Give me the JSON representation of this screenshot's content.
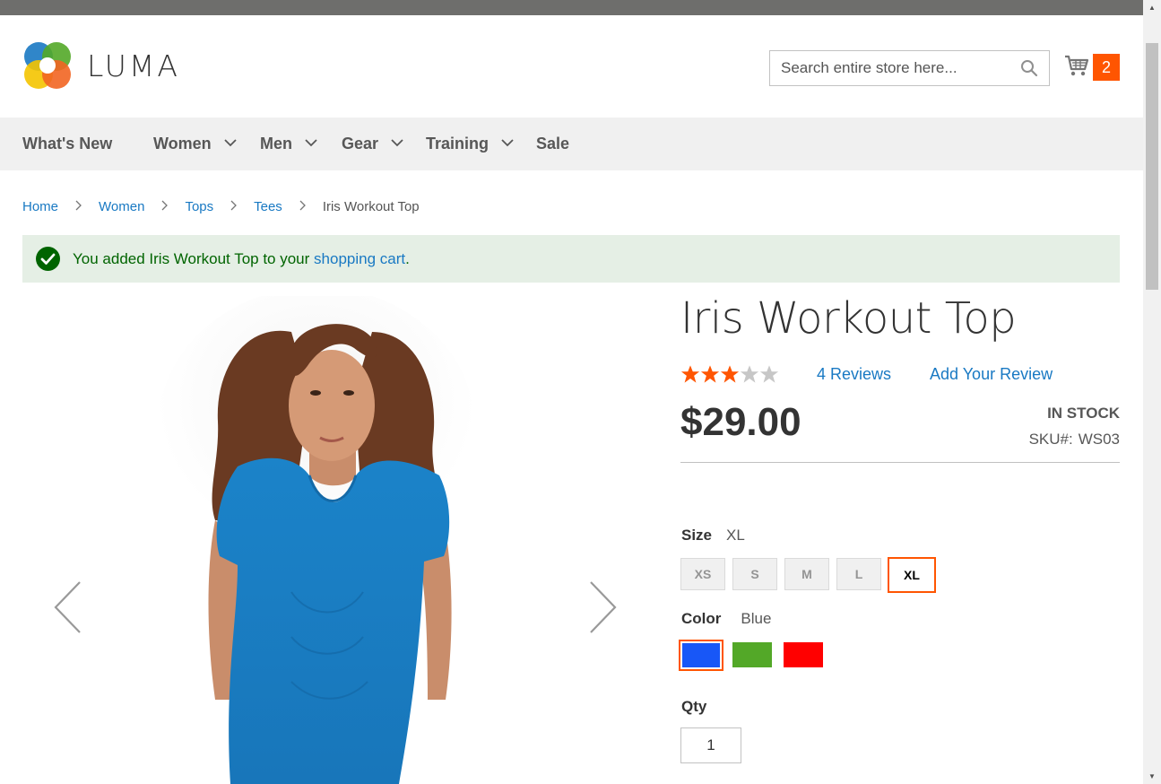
{
  "header": {
    "logo_text": "LUMA",
    "search": {
      "placeholder": "Search entire store here...",
      "value": ""
    },
    "cart": {
      "count": "2"
    }
  },
  "nav": {
    "items": [
      {
        "label": "What's New",
        "has_dropdown": false
      },
      {
        "label": "Women",
        "has_dropdown": true
      },
      {
        "label": "Men",
        "has_dropdown": true
      },
      {
        "label": "Gear",
        "has_dropdown": true
      },
      {
        "label": "Training",
        "has_dropdown": true
      },
      {
        "label": "Sale",
        "has_dropdown": false
      }
    ]
  },
  "breadcrumb": {
    "items": [
      "Home",
      "Women",
      "Tops",
      "Tees"
    ],
    "current": "Iris Workout Top"
  },
  "message": {
    "text_before": "You added Iris Workout Top to your ",
    "link_text": "shopping cart",
    "text_after": "."
  },
  "product": {
    "title": "Iris Workout Top",
    "rating": {
      "stars": 3,
      "max": 5
    },
    "reviews_link": "4  Reviews",
    "add_review_link": "Add Your Review",
    "price": "$29.00",
    "stock": "IN STOCK",
    "sku_label": "SKU#:",
    "sku_value": "WS03",
    "size": {
      "label": "Size",
      "selected": "XL",
      "options": [
        "XS",
        "S",
        "M",
        "L",
        "XL"
      ]
    },
    "color": {
      "label": "Color",
      "selected": "Blue",
      "options": [
        {
          "name": "Blue",
          "hex": "#1857f7"
        },
        {
          "name": "Green",
          "hex": "#53a828"
        },
        {
          "name": "Red",
          "hex": "#ff0000"
        }
      ]
    },
    "qty": {
      "label": "Qty",
      "value": "1"
    }
  },
  "colors": {
    "accent": "#ff5501",
    "link": "#1979c3",
    "success_bg": "#e5efe5",
    "success_text": "#006400",
    "star_filled": "#ff5501",
    "star_empty": "#c7c7c7"
  }
}
